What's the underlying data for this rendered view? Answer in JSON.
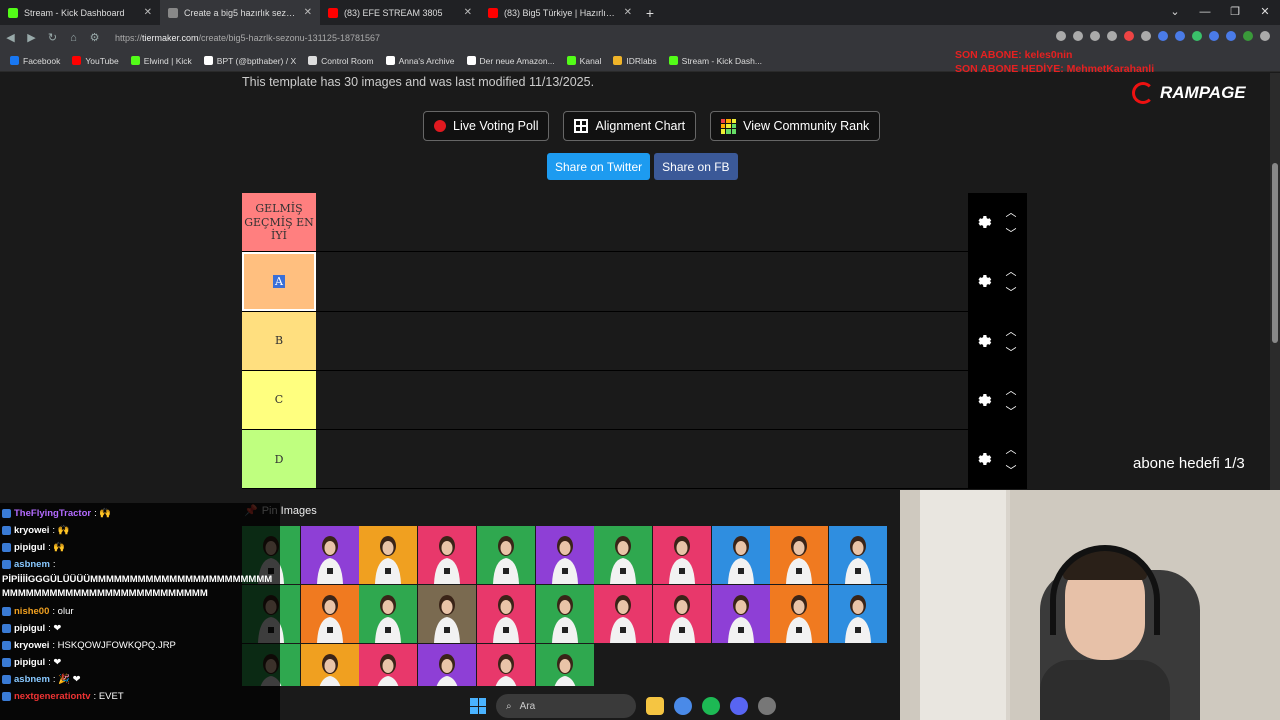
{
  "browser": {
    "tabs": [
      {
        "title": "Stream - Kick Dashboard",
        "color": "#53fc18",
        "active": false
      },
      {
        "title": "Create a big5 hazırlık sezonu (1...",
        "color": "#888888",
        "active": true
      },
      {
        "title": "(83) EFE STREAM 3805",
        "color": "#ff0000",
        "active": false
      },
      {
        "title": "(83) Big5 Türkiye | Hazırlık Sezon",
        "color": "#ff0000",
        "active": false
      }
    ],
    "tab_close": "✕",
    "new_tab": "+",
    "window_controls": [
      "⌄",
      "—",
      "❐",
      "✕"
    ],
    "url_prefix": "https://",
    "url_host": "tiermaker.com",
    "url_path": "/create/big5-hazrlk-sezonu-131125-18781567",
    "bookmarks": [
      {
        "label": "Facebook",
        "color": "#1877f2"
      },
      {
        "label": "YouTube",
        "color": "#ff0000"
      },
      {
        "label": "Elwind | Kick",
        "color": "#53fc18"
      },
      {
        "label": "BPT (@bpthaber) / X",
        "color": "#ffffff"
      },
      {
        "label": "Control Room",
        "color": "#dddddd"
      },
      {
        "label": "Anna's Archive",
        "color": "#ffffff"
      },
      {
        "label": "Der neue Amazon...",
        "color": "#ffffff"
      },
      {
        "label": "Kanal",
        "color": "#53fc18"
      },
      {
        "label": "IDRlabs",
        "color": "#f0b429"
      },
      {
        "label": "Stream - Kick Dash...",
        "color": "#53fc18"
      }
    ]
  },
  "page": {
    "meta_text": "This template has 30 images and was last modified 11/13/2025.",
    "buttons": {
      "live_voting": "Live Voting Poll",
      "alignment": "Alignment Chart",
      "community": "View Community Rank"
    },
    "share": {
      "twitter": "Share on Twitter",
      "facebook": "Share on FB"
    },
    "tiers": [
      {
        "label": "GELMİŞ GEÇMİŞ EN İYİ",
        "color": "#ff7f7f",
        "selected": false
      },
      {
        "label": "A",
        "color": "#ffbf7f",
        "selected": true
      },
      {
        "label": "B",
        "color": "#ffdf7f",
        "selected": false
      },
      {
        "label": "C",
        "color": "#ffff7f",
        "selected": false
      },
      {
        "label": "D",
        "color": "#bfff7f",
        "selected": false
      }
    ],
    "pin_label": "Pin Images",
    "thumb_colors": [
      "#2fa84f",
      "#8e3fd6",
      "#f0a020",
      "#e8386b",
      "#2fa84f",
      "#8e3fd6",
      "#2fa84f",
      "#e8386b",
      "#2f8ee0",
      "#f07a20",
      "#2f8ee0",
      "#2fa84f",
      "#f07a20",
      "#2fa84f",
      "#7a6a50",
      "#e8386b",
      "#2fa84f",
      "#e8386b",
      "#e8386b",
      "#8e3fd6",
      "#f07a20",
      "#2f8ee0",
      "#2fa84f",
      "#f0a020",
      "#e8386b",
      "#8e3fd6",
      "#e8386b",
      "#2fa84f"
    ]
  },
  "overlay": {
    "abone_top": [
      "SON ABONE: keles0nin",
      "SON ABONE HEDİYE: MehmetKarahanli"
    ],
    "rampage": "RAMPAGE",
    "abone_hedef": "abone hedefi 1/3",
    "chat": [
      {
        "user": "TheFlyingTractor",
        "msg": ": 🙌",
        "color": "#b36bff"
      },
      {
        "user": "kryowei",
        "msg": ": 🙌",
        "color": "#ffffff"
      },
      {
        "user": "pipigul",
        "msg": ": 🙌",
        "color": "#ffffff"
      },
      {
        "user": "asbnem",
        "msg": ":",
        "color": "#88c8ff"
      },
      {
        "user": "",
        "msg": "PİPİİİİGGGÜLÜÜÜÜMMMMMMMMMMMMMMMMMMMMMMMMMMMMMMMMMMMMMMMMMMMMMMMMM",
        "color": "#ffffff",
        "multi": true
      },
      {
        "user": "nishe00",
        "msg": ": olur",
        "color": "#f0a020"
      },
      {
        "user": "pipigul",
        "msg": ": ❤",
        "color": "#ffffff"
      },
      {
        "user": "kryowei",
        "msg": ": HSKQOWJFOWKQPQ.JRP",
        "color": "#ffffff"
      },
      {
        "user": "pipigul",
        "msg": ": ❤",
        "color": "#ffffff"
      },
      {
        "user": "asbnem",
        "msg": ": 🎉 ❤",
        "color": "#88c8ff"
      },
      {
        "user": "nextgenerationtv",
        "msg": ": EVET",
        "color": "#e33"
      }
    ]
  },
  "taskbar": {
    "search_placeholder": "Ara"
  }
}
